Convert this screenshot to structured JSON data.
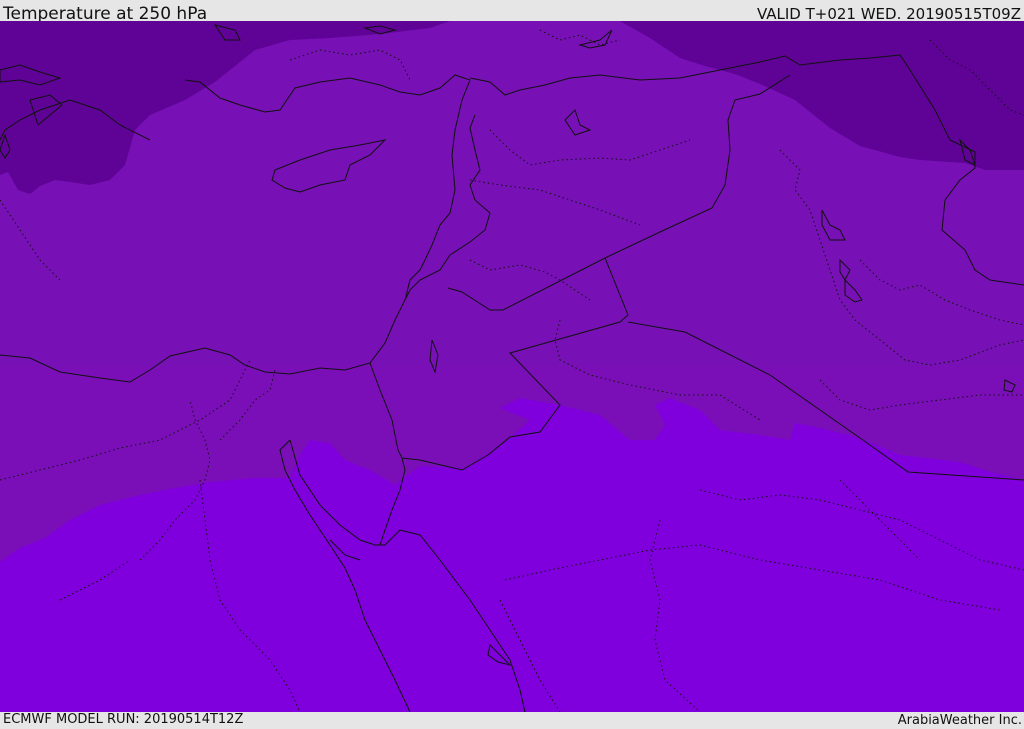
{
  "header": {
    "title": "Temperature at 250 hPa",
    "valid": "VALID T+021 WED. 20190515T09Z"
  },
  "footer": {
    "model_run": "ECMWF MODEL RUN: 20190514T12Z",
    "credit": "ArabiaWeather Inc."
  },
  "colors": {
    "band_cold": "#5f0396",
    "band_mid": "#7710b5",
    "band_mid_south": "#7a0fb8",
    "band_warm": "#7f00dc",
    "border": "#111111",
    "bar_background": "#e6e6e6"
  }
}
